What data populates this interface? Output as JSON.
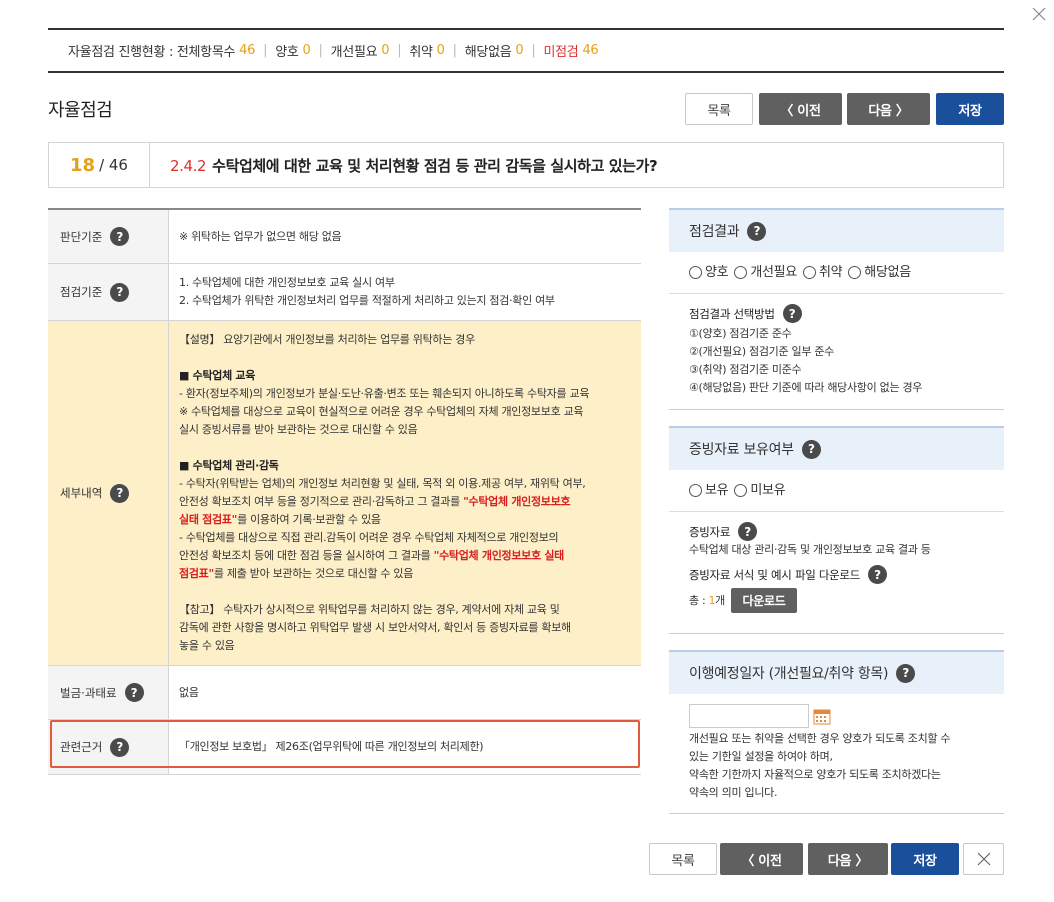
{
  "status": {
    "label": "자율점검 진행현황 : 전체항목수",
    "total": "46",
    "good_label": "양호",
    "good": "0",
    "improve_label": "개선필요",
    "improve": "0",
    "weak_label": "취약",
    "weak": "0",
    "na_label": "해당없음",
    "na": "0",
    "unchecked_label": "미점검",
    "unchecked": "46"
  },
  "page": {
    "title": "자율점검"
  },
  "top_buttons": {
    "list": "목록",
    "prev": "〈 이전",
    "next": "다음 〉",
    "save": "저장"
  },
  "question": {
    "current": "18",
    "total": "/ 46",
    "code": "2.4.2",
    "text": "수탁업체에 대한 교육 및 처리현황 점검 등 관리 감독을 실시하고 있는가?"
  },
  "table": {
    "criteria_head": "판단기준",
    "criteria": "※ 위탁하는 업무가 없으면 해당 없음",
    "check_head": "점검기준",
    "check_1": "1. 수탁업체에 대한 개인정보보호 교육 실시 여부",
    "check_2": "2. 수탁업체가 위탁한 개인정보처리 업무를 적절하게 처리하고 있는지 점검·확인 여부",
    "detail_head": "세부내역",
    "d1": "【설명】 요양기관에서 개인정보를 처리하는 업무를 위탁하는 경우",
    "d2": "■ 수탁업체 교육",
    "d3": "- 환자(정보주체)의 개인정보가 분실·도난·유출·변조 또는 훼손되지 아니하도록 수탁자를 교육",
    "d4": "※ 수탁업체를 대상으로 교육이 현실적으로 어려운 경우 수탁업체의 자체 개인정보보호 교육",
    "d5": "실시 증빙서류를 받아 보관하는 것으로 대신할 수 있음",
    "d6": "■ 수탁업체 관리·감독",
    "d7": "- 수탁자(위탁받는 업체)의 개인정보 처리현황 및 실태, 목적 외 이용.제공 여부, 재위탁 여부,",
    "d8a": "안전성 확보조치 여부 등을 정기적으로 관리·감독하고 그 결과를 ",
    "d8b": "\"수탁업체 개인정보보호",
    "d9a": "실태 점검표\"",
    "d9b": "를 이용하여 기록·보관할 수 있음",
    "d10": "- 수탁업체를 대상으로 직접 관리.감독이 어려운 경우 수탁업체 자체적으로 개인정보의",
    "d11a": "안전성 확보조치 등에 대한 점검 등을 실시하여 그 결과를 ",
    "d11b": "\"수탁업체 개인정보보호 실태",
    "d12a": "점검표\"",
    "d12b": "를 제출 받아 보관하는 것으로 대신할 수 있음",
    "d13": "【참고】 수탁자가 상시적으로 위탁업무를 처리하지 않는 경우, 계약서에 자체 교육 및",
    "d14": "감독에 관한 사항을 명시하고 위탁업무 발생 시 보안서약서, 확인서 등 증빙자료를 확보해",
    "d15": "놓을 수 있음",
    "penalty_head": "벌금·과태료",
    "penalty": "없음",
    "basis_head": "관련근거",
    "basis": "「개인정보 보호법」 제26조(업무위탁에 따른 개인정보의 처리제한)"
  },
  "result": {
    "head": "점검결과",
    "options": [
      "양호",
      "개선필요",
      "취약",
      "해당없음"
    ],
    "method_title": "점검결과 선택방법",
    "m1": "①(양호) 점검기준 준수",
    "m2": "②(개선필요) 점검기준 일부 준수",
    "m3": "③(취약) 점검기준 미준수",
    "m4": "④(해당없음) 판단 기준에 따라 해당사항이 없는 경우"
  },
  "evidence": {
    "head": "증빙자료 보유여부",
    "options": [
      "보유",
      "미보유"
    ],
    "doc_title": "증빙자료",
    "doc_text": "수탁업체 대상 관리·감독 및 개인정보보호 교육 결과 등",
    "download_title": "증빙자료 서식 및 예시 파일 다운로드",
    "total_label": "총 :",
    "total_count": "1",
    "total_unit": "개",
    "download_btn": "다운로드"
  },
  "schedule": {
    "head": "이행예정일자 (개선필요/취약 항목)",
    "date_value": "",
    "n1": "개선필요 또는 취약을 선택한 경우 양호가 되도록 조치할 수",
    "n2": "있는 기한일 설정을 하여야 하며,",
    "n3": "약속한 기한까지 자율적으로 양호가 되도록 조치하겠다는",
    "n4": "약속의 의미 입니다."
  },
  "bottom_buttons": {
    "list": "목록",
    "prev": "〈 이전",
    "next": "다음 〉",
    "save": "저장"
  },
  "icons": {
    "help": "?",
    "close": "×"
  },
  "colors": {
    "accent_orange": "#e6a01a",
    "accent_red": "#e03030",
    "save_blue": "#1a4f9c",
    "detail_bg": "#fdefc8",
    "panel_head_bg": "#e8f0fa"
  }
}
